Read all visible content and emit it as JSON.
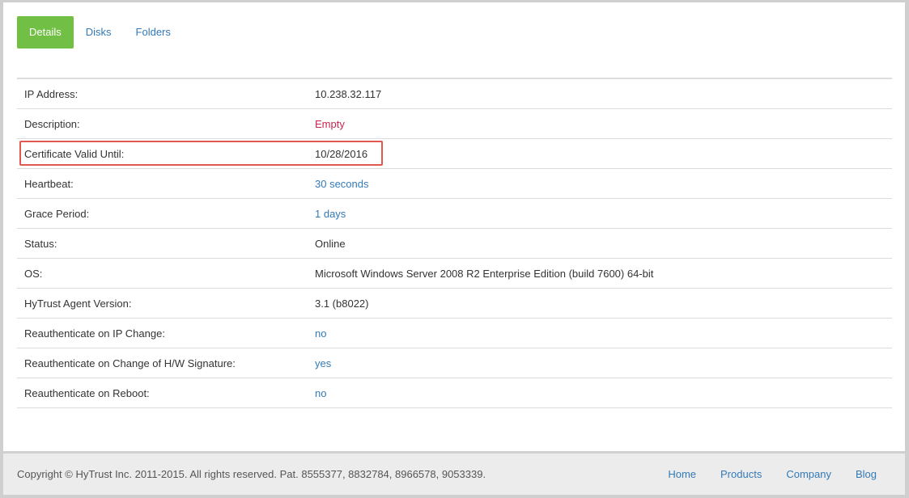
{
  "tabs": [
    {
      "label": "Details",
      "active": true
    },
    {
      "label": "Disks",
      "active": false
    },
    {
      "label": "Folders",
      "active": false
    }
  ],
  "details": [
    {
      "label": "IP Address:",
      "value": "10.238.32.117",
      "style": "dark"
    },
    {
      "label": "Description:",
      "value": "Empty",
      "style": "red"
    },
    {
      "label": "Certificate Valid Until:",
      "value": "10/28/2016",
      "style": "dark",
      "highlighted": true
    },
    {
      "label": "Heartbeat:",
      "value": "30 seconds",
      "style": "blue"
    },
    {
      "label": "Grace Period:",
      "value": "1 days",
      "style": "blue"
    },
    {
      "label": "Status:",
      "value": "Online",
      "style": "dark"
    },
    {
      "label": "OS:",
      "value": "Microsoft Windows Server 2008 R2 Enterprise Edition (build 7600) 64-bit",
      "style": "dark"
    },
    {
      "label": "HyTrust Agent Version:",
      "value": "3.1 (b8022)",
      "style": "dark"
    },
    {
      "label": "Reauthenticate on IP Change:",
      "value": "no",
      "style": "blue"
    },
    {
      "label": "Reauthenticate on Change of H/W Signature:",
      "value": "yes",
      "style": "blue"
    },
    {
      "label": "Reauthenticate on Reboot:",
      "value": "no",
      "style": "blue"
    }
  ],
  "footer": {
    "copyright": "Copyright © HyTrust Inc. 2011-2015. All rights reserved. Pat. 8555377, 8832784, 8966578, 9053339.",
    "links": [
      "Home",
      "Products",
      "Company",
      "Blog"
    ]
  },
  "colors": {
    "accent_green": "#71bf45",
    "link_blue": "#337ab7",
    "empty_red": "#c7254e",
    "highlight_red": "#e0584f"
  }
}
